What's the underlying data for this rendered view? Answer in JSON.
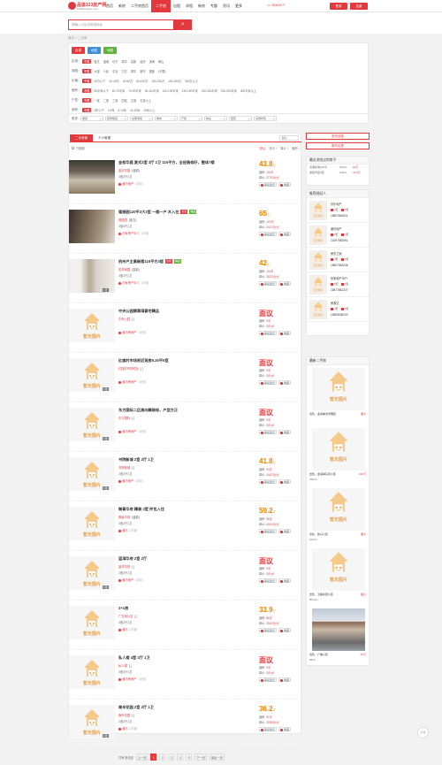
{
  "header": {
    "logo_main": "品鉴",
    "logo_num": "123",
    "logo_suffix": "房产网",
    "logo_url": "123fangchan.com",
    "nav": [
      "首页",
      "新房",
      "二手房首页",
      "二手房",
      "出租",
      "求租",
      "新房",
      "专题",
      "资讯",
      "更多"
    ],
    "nav_active_index": 3,
    "hotline": "☏ 0536-8***",
    "login": "登录",
    "register": "注册"
  },
  "search": {
    "placeholder": "请输入小区名称或地址",
    "button_icon": "search-icon"
  },
  "breadcrumb": "首页 > 二手房",
  "filter": {
    "tabs": [
      {
        "label": "区域",
        "color": "#e4393c"
      },
      {
        "label": "地铁",
        "color": "#3b8fd9"
      },
      {
        "label": "地图",
        "color": "#5fb336"
      }
    ],
    "rows": [
      {
        "label": "区域:",
        "options": [
          "不限",
          "奎文",
          "潍城",
          "坊子",
          "寒亭",
          "高新",
          "经济",
          "滨海",
          "峡山"
        ],
        "active": 0
      },
      {
        "label": "商圈:",
        "options": [
          "不限",
          "大观",
          "人民",
          "中百",
          "万达",
          "泰华",
          "新华",
          "银座",
          "(不限)"
        ],
        "active": 0
      },
      {
        "label": "价格:",
        "options": [
          "不限",
          "20万以下",
          "20-40万",
          "40-60万",
          "60-100万",
          "100-150万",
          "150-300万",
          "300万以上"
        ],
        "active": 0
      },
      {
        "label": "面积:",
        "options": [
          "不限",
          "50平米以下",
          "50-70平米",
          "70-90平米",
          "90-110平米",
          "110-130平米",
          "130-150平米",
          "150-200平米",
          "200-300平米",
          "300平米以上"
        ],
        "active": 0
      },
      {
        "label": "户型:",
        "options": [
          "不限",
          "一室",
          "二室",
          "三室",
          "四室",
          "五室",
          "五室以上"
        ],
        "active": 0
      },
      {
        "label": "房龄:",
        "options": [
          "不限",
          "2年以下",
          "2-5年",
          "5-10年",
          "10-20年",
          "20年以上"
        ],
        "active": 0
      }
    ],
    "more_label": "更多:",
    "dropdowns": [
      "楼层",
      "装修程度",
      "房屋类型",
      "朝向",
      "产权",
      "物业",
      "配套",
      "房屋特色"
    ]
  },
  "list": {
    "tabs": [
      "二手房源",
      "个人房源"
    ],
    "sort_select": "默认",
    "toolbar_left": "只看图",
    "sorts": [
      "默认",
      "总价 ↕",
      "单价 ↕",
      "面积 ↕"
    ],
    "items": [
      {
        "title": "金桂华庭 复式3室 3厅 2卫 116平方，全经装修好，整体7楼",
        "tags": [],
        "community": "金桂华庭",
        "district": "[潍城]",
        "info": "3室2厅1卫",
        "agent": "潍坊地产",
        "time": "1天前",
        "price": "43.8",
        "unit": "万",
        "area": "116平",
        "unitprice": "3776元/㎡",
        "photos": "",
        "img": "photo1"
      },
      {
        "title": "德振园120平3大3室 一楼一户 木入住",
        "tags": [
          "jj",
          "jp"
        ],
        "community": "德振园",
        "district": "[奎文]",
        "info": "3室2厅1卫",
        "agent": "万家房产中介",
        "time": "1天前",
        "price": "65",
        "unit": "万",
        "area": "120平",
        "unitprice": "5417元/㎡",
        "photos": "",
        "img": "photo2"
      },
      {
        "title": "杭州户主高新楼116平方3居",
        "tags": [
          "jj",
          "jp"
        ],
        "community": "宏邦家园",
        "district": "[高新]",
        "info": "3室2厅1卫",
        "agent": "万家房产中介",
        "time": "1天前",
        "price": "42",
        "unit": "万",
        "area": "116平",
        "unitprice": "3621元/㎡",
        "photos": "1张",
        "img": "photo3"
      },
      {
        "title": "中央公园翡翠湾豪宅精品",
        "tags": [],
        "community": "中央公园",
        "district": "[ ]",
        "info": "",
        "agent": "潍坊房地产",
        "time": "1天前",
        "price": "面议",
        "unit": "",
        "area": "0平",
        "unitprice": "0元/㎡",
        "photos": "",
        "img": "noimg"
      },
      {
        "title": "红旗村市场附近现房5.26平5室",
        "tags": [],
        "community": "红旗村市场附近",
        "district": "[ ]",
        "info": "",
        "agent": "潍坊房地产",
        "time": "1天前",
        "price": "面议",
        "unit": "",
        "area": "0平",
        "unitprice": "0元/㎡",
        "photos": "1张",
        "img": "noimg"
      },
      {
        "title": "东方国际二区南向精装修，户型方正",
        "tags": [],
        "community": "东方国际",
        "district": "[ ]",
        "info": "",
        "agent": "潍坊房地产",
        "time": "1天前",
        "price": "面议",
        "unit": "",
        "area": "0平",
        "unitprice": "0元/㎡",
        "photos": "1张",
        "img": "noimg"
      },
      {
        "title": "书院新城 2室 2厅 1卫",
        "tags": [],
        "community": "书院新城",
        "district": "[ ]",
        "info": "2室2厅1卫",
        "agent": "潍坊地产",
        "time": "1天前",
        "price": "41.8",
        "unit": "万",
        "area": "94平",
        "unitprice": "4447元/㎡",
        "photos": "1张",
        "img": "noimg"
      },
      {
        "title": "御景华府 精装 3室 拎包入住",
        "tags": [],
        "community": "御景华府",
        "district": "[潍城]",
        "info": "3室2厅1卫",
        "agent": "潍坊",
        "time": "1天前",
        "price": "59.2",
        "unit": "万",
        "area": "98平",
        "unitprice": "6041元/㎡",
        "photos": "",
        "img": "noimg"
      },
      {
        "title": "蓝湾华府 2室 2厅",
        "tags": [],
        "community": "蓝湾华府",
        "district": "[ ]",
        "info": "2室2厅1卫",
        "agent": "潍坊地产",
        "time": "1天前",
        "price": "面议",
        "unit": "",
        "area": "0平",
        "unitprice": "0元/㎡",
        "photos": "1张",
        "img": "noimg"
      },
      {
        "title": "2+1房",
        "tags": [],
        "community": "广文街片区",
        "district": "[ ]",
        "info": "3室2厅1卫",
        "agent": "潍坊",
        "time": "1天前",
        "price": "33.9",
        "unit": "万",
        "area": "86平",
        "unitprice": "3942元/㎡",
        "photos": "",
        "img": "noimg"
      },
      {
        "title": "私人楼 4室 3厅 1卫",
        "tags": [],
        "community": "私人楼",
        "district": "[ ]",
        "info": "4室3厅1卫",
        "agent": "潍坊房地产",
        "time": "1天前",
        "price": "面议",
        "unit": "",
        "area": "0平",
        "unitprice": "0元/㎡",
        "photos": "",
        "img": "noimg"
      },
      {
        "title": "南辛花园 2室 2厅 1卫",
        "tags": [],
        "community": "南辛花园",
        "district": "[ ]",
        "info": "2室2厅1卫",
        "agent": "潍坊",
        "time": "1天前",
        "price": "36.2",
        "unit": "万",
        "area": "92平",
        "unitprice": "3935元/㎡",
        "photos": "1张",
        "img": "noimg"
      }
    ],
    "action_contact": "联系我们",
    "action_fav": "收藏",
    "tag_jj": "急售",
    "tag_jp": "精品",
    "noimg_label": "暂无图片",
    "pager": {
      "summary": "共有 条信息",
      "prev": "上一页",
      "pages": [
        "1",
        "2",
        "3",
        "4",
        "5"
      ],
      "active": 0,
      "next": "下一页",
      "last": "最后一页"
    }
  },
  "right": {
    "btn_post": "发布信息",
    "btn_entrust": "委托出售",
    "compare_title": "最近浏览过的房子",
    "compare_rows": [
      [
        "滨浦新城120平",
        "120m²",
        "60万"
      ],
      [
        "金桂华庭3室",
        "116m²",
        "43.8万"
      ]
    ],
    "agents_title": "推荐经纪人",
    "agents": [
      {
        "name": "好乐地产",
        "b1": "2套",
        "b2": "2套",
        "phone": "15807664521"
      },
      {
        "name": "潍坊地产",
        "b1": "0套",
        "b2": "0套",
        "phone": "13297082061"
      },
      {
        "name": "房东之家",
        "b1": "3套",
        "b2": "3套",
        "phone": "15607362236"
      },
      {
        "name": "玖家地产中介",
        "b1": "0套",
        "b2": "2套",
        "phone": "15877861327"
      },
      {
        "name": "房源达",
        "b1": "0套",
        "b2": "0套",
        "phone": "13853185030"
      }
    ],
    "newest_title": "最新二手房",
    "newest": [
      {
        "caption": "出售，金海岸滨河雅苑",
        "price": "面议",
        "area": "",
        "img": "noimg"
      },
      {
        "caption": "出售，金海岸东风小区",
        "price": "340万",
        "area": "322m²",
        "img": "noimg"
      },
      {
        "caption": "出售，新兴小区",
        "price": "面议",
        "area": "102m²",
        "img": "noimg"
      },
      {
        "caption": "出售，五福泰康小区",
        "price": "面议",
        "area": "80.9m²",
        "img": "noimg"
      },
      {
        "caption": "出售，广福小区",
        "price": "32万",
        "area": "36m²",
        "img": "photo"
      }
    ]
  },
  "feedback_label": "反馈"
}
